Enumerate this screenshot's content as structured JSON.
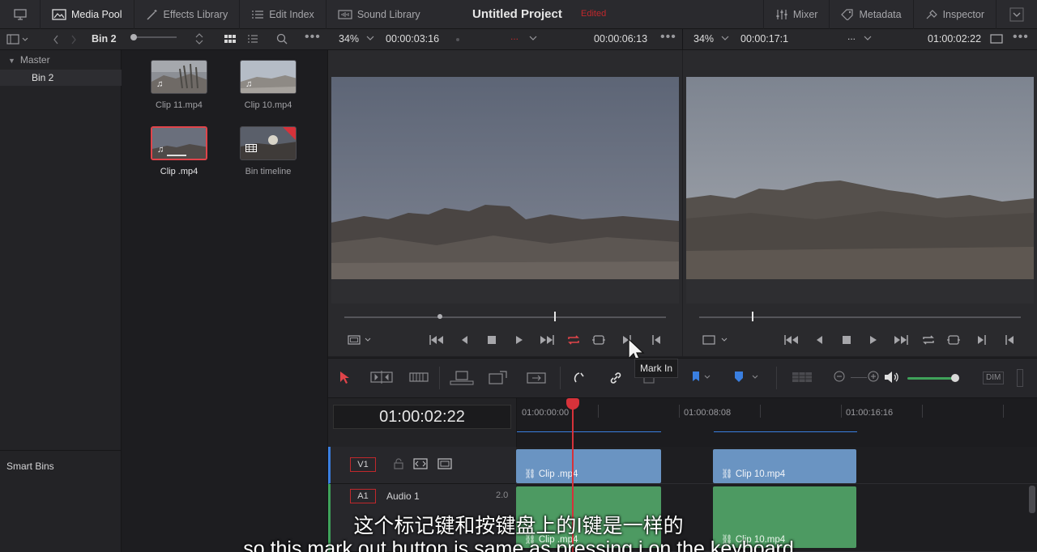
{
  "topbar": {
    "modules": [
      {
        "label": "Media Pool",
        "icon": "media-pool-icon",
        "active": true
      },
      {
        "label": "Effects Library",
        "icon": "effects-icon"
      },
      {
        "label": "Edit Index",
        "icon": "list-icon"
      },
      {
        "label": "Sound Library",
        "icon": "sound-icon"
      }
    ],
    "project_title": "Untitled Project",
    "status": "Edited",
    "right": [
      {
        "label": "Mixer",
        "icon": "mixer-icon"
      },
      {
        "label": "Metadata",
        "icon": "metadata-icon"
      },
      {
        "label": "Inspector",
        "icon": "inspector-icon"
      }
    ]
  },
  "subbar": {
    "bin_name": "Bin 2",
    "source_zoom": "34%",
    "source_tc": "00:00:03:16",
    "source_duration": "00:00:06:13",
    "program_zoom": "34%",
    "program_tc": "00:00:17:1",
    "program_name": "...",
    "program_duration": "01:00:02:22"
  },
  "bins": {
    "master": "Master",
    "selected": "Bin 2",
    "smart_bins": "Smart Bins"
  },
  "clips": [
    {
      "name": "Clip 11.mp4"
    },
    {
      "name": "Clip 10.mp4"
    },
    {
      "name": "Clip .mp4"
    },
    {
      "name": "Bin timeline"
    }
  ],
  "timeline": {
    "timecode": "01:00:02:22",
    "ruler": [
      "01:00:00:00",
      "01:00:08:08",
      "01:00:16:16"
    ],
    "tracks": {
      "v1": {
        "label": "V1"
      },
      "a1": {
        "label": "A1",
        "name": "Audio 1",
        "channels": "2.0"
      }
    },
    "video_clips": [
      "Clip .mp4",
      "Clip 10.mp4"
    ],
    "audio_clips": [
      "Clip .mp4",
      "Clip 10.mp4"
    ]
  },
  "tooltip": "Mark In",
  "subtitles": {
    "cn": "这个标记键和按键盘上的I键是一样的",
    "en": "so this mark out button is same as pressing i on the keyboard"
  },
  "colors": {
    "accent_red": "#d6323a",
    "video_clip": "#6a94c2",
    "audio_clip": "#4d9a62"
  }
}
